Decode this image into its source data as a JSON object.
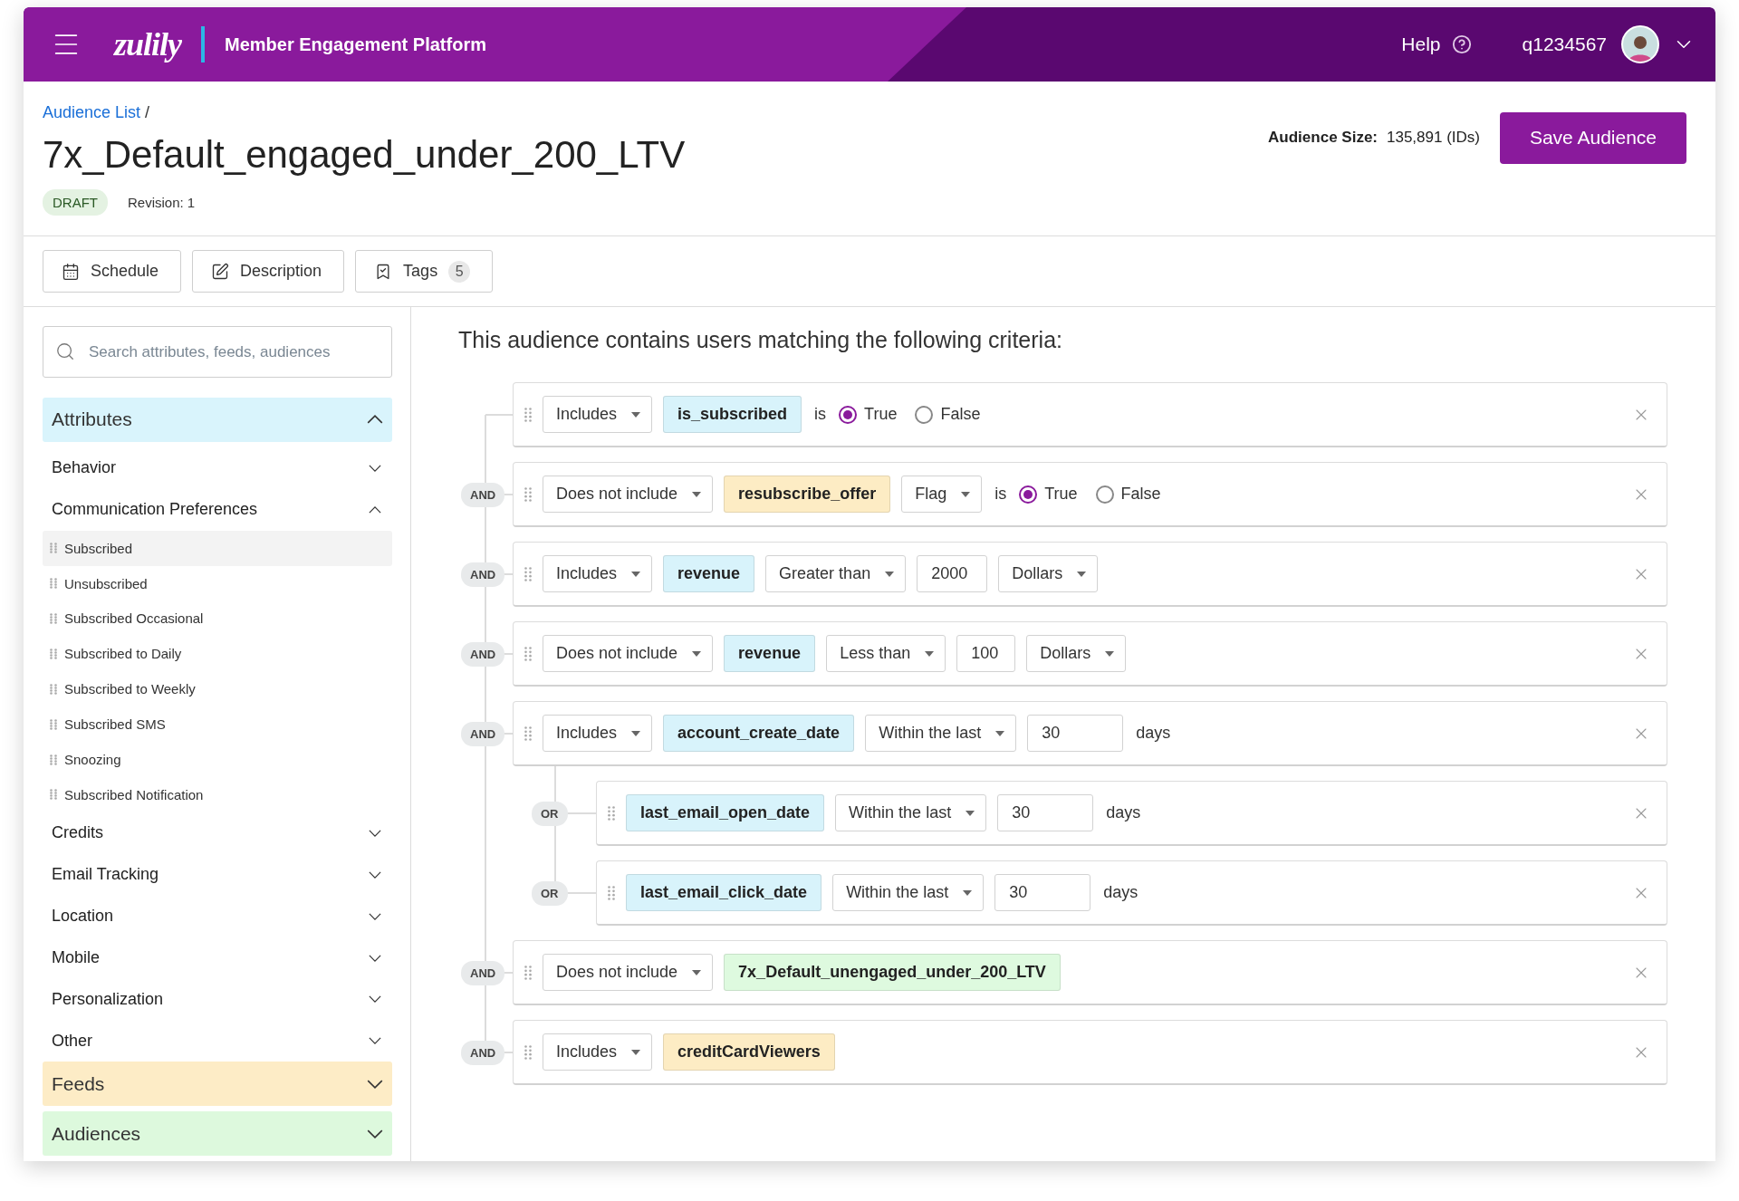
{
  "header": {
    "logo": "zulily",
    "title": "Member Engagement Platform",
    "help": "Help",
    "user": "q1234567"
  },
  "breadcrumb": {
    "link": "Audience List",
    "separator": "/"
  },
  "title": "7x_Default_engaged_under_200_LTV",
  "status": "DRAFT",
  "revision": "Revision: 1",
  "audience_size": {
    "label": "Audience Size:",
    "value": "135,891 (IDs)"
  },
  "save_button": "Save Audience",
  "toolbar": [
    {
      "kind": "schedule",
      "label": "Schedule"
    },
    {
      "kind": "description",
      "label": "Description"
    },
    {
      "kind": "tags",
      "label": "Tags",
      "count": "5"
    }
  ],
  "sidebar": {
    "search_placeholder": "Search attributes, feeds, audiences",
    "sections": [
      {
        "label": "Attributes",
        "color": "#d9f4fc",
        "expanded": true,
        "categories": [
          {
            "label": "Behavior",
            "expanded": false
          },
          {
            "label": "Communication Preferences",
            "expanded": true,
            "items": [
              {
                "label": "Subscribed",
                "selected": true
              },
              {
                "label": "Unsubscribed",
                "selected": false
              },
              {
                "label": "Subscribed Occasional",
                "selected": false
              },
              {
                "label": "Subscribed to Daily",
                "selected": false
              },
              {
                "label": "Subscribed to Weekly",
                "selected": false
              },
              {
                "label": "Subscribed SMS",
                "selected": false
              },
              {
                "label": "Snoozing",
                "selected": false
              },
              {
                "label": "Subscribed Notification",
                "selected": false
              }
            ]
          },
          {
            "label": "Credits",
            "expanded": false
          },
          {
            "label": "Email Tracking",
            "expanded": false
          },
          {
            "label": "Location",
            "expanded": false
          },
          {
            "label": "Mobile",
            "expanded": false
          },
          {
            "label": "Personalization",
            "expanded": false
          },
          {
            "label": "Other",
            "expanded": false
          }
        ]
      },
      {
        "label": "Feeds",
        "color": "#fdecc6",
        "expanded": false
      },
      {
        "label": "Audiences",
        "color": "#ddf9dd",
        "expanded": false
      }
    ]
  },
  "criteria": {
    "heading": "This audience contains users matching the following criteria:",
    "rows": [
      {
        "items": [
          {
            "kind": "select",
            "value": "Includes"
          },
          {
            "kind": "attribute",
            "label": "is_subscribed",
            "color": "#d8f3fb"
          },
          {
            "kind": "text",
            "label": "is"
          },
          {
            "kind": "radio",
            "label": "True",
            "selected": true
          },
          {
            "kind": "radio",
            "label": "False",
            "selected": false
          }
        ]
      },
      {
        "connector": "AND",
        "items": [
          {
            "kind": "select",
            "value": "Does not include"
          },
          {
            "kind": "attribute",
            "label": "resubscribe_offer",
            "color": "#fdecc4"
          },
          {
            "kind": "select",
            "value": "Flag"
          },
          {
            "kind": "text",
            "label": "is"
          },
          {
            "kind": "radio",
            "label": "True",
            "selected": true
          },
          {
            "kind": "radio",
            "label": "False",
            "selected": false
          }
        ]
      },
      {
        "connector": "AND",
        "items": [
          {
            "kind": "select",
            "value": "Includes"
          },
          {
            "kind": "attribute",
            "label": "revenue",
            "color": "#d8f3fb"
          },
          {
            "kind": "select",
            "value": "Greater than"
          },
          {
            "kind": "input",
            "value": "2000"
          },
          {
            "kind": "select",
            "value": "Dollars"
          }
        ]
      },
      {
        "connector": "AND",
        "items": [
          {
            "kind": "select",
            "value": "Does not include"
          },
          {
            "kind": "attribute",
            "label": "revenue",
            "color": "#d8f3fb"
          },
          {
            "kind": "select",
            "value": "Less than"
          },
          {
            "kind": "input",
            "value": "100"
          },
          {
            "kind": "select",
            "value": "Dollars"
          }
        ]
      },
      {
        "connector": "AND",
        "items": [
          {
            "kind": "select",
            "value": "Includes"
          },
          {
            "kind": "attribute",
            "label": "account_create_date",
            "color": "#d8f3fb"
          },
          {
            "kind": "select",
            "value": "Within the last"
          },
          {
            "kind": "input",
            "value": "30"
          },
          {
            "kind": "text",
            "label": "days"
          }
        ],
        "children": [
          {
            "connector": "OR",
            "items": [
              {
                "kind": "attribute",
                "label": "last_email_open_date",
                "color": "#d8f3fb"
              },
              {
                "kind": "select",
                "value": "Within the last"
              },
              {
                "kind": "input",
                "value": "30"
              },
              {
                "kind": "text",
                "label": "days"
              }
            ]
          },
          {
            "connector": "OR",
            "items": [
              {
                "kind": "attribute",
                "label": "last_email_click_date",
                "color": "#d8f3fb"
              },
              {
                "kind": "select",
                "value": "Within the last"
              },
              {
                "kind": "input",
                "value": "30"
              },
              {
                "kind": "text",
                "label": "days"
              }
            ]
          }
        ]
      },
      {
        "connector": "AND",
        "items": [
          {
            "kind": "select",
            "value": "Does not include"
          },
          {
            "kind": "attribute",
            "label": "7x_Default_unengaged_under_200_LTV",
            "color": "#defadf"
          }
        ]
      },
      {
        "connector": "AND",
        "items": [
          {
            "kind": "select",
            "value": "Includes"
          },
          {
            "kind": "attribute",
            "label": "creditCardViewers",
            "color": "#fdecc4"
          }
        ]
      }
    ]
  }
}
